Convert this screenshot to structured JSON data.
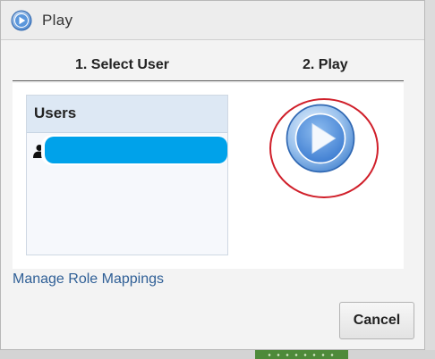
{
  "dialog": {
    "title": "Play",
    "title_icon": "play-circle-icon"
  },
  "steps": {
    "step1": "1. Select User",
    "step2": "2. Play"
  },
  "users": {
    "header": "Users",
    "selected_row_icon": "person-icon"
  },
  "play_button": {
    "icon": "play-circle-icon",
    "highlight_color": "#d01f2a"
  },
  "links": {
    "manage_role_mappings": "Manage Role Mappings"
  },
  "buttons": {
    "cancel": "Cancel"
  },
  "colors": {
    "selection": "#00a2ea",
    "link": "#2f5f96"
  }
}
